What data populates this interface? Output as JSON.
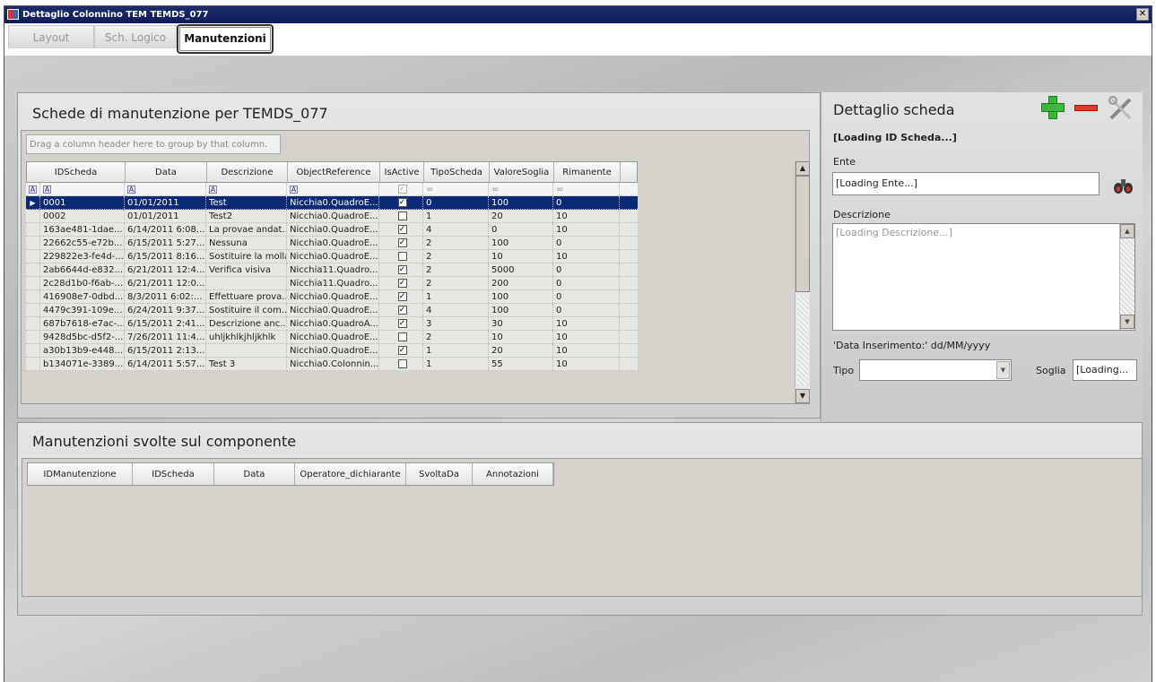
{
  "window": {
    "title": "Dettaglio Colonnino TEM TEMDS_077",
    "close_glyph": "✕"
  },
  "tabs": [
    {
      "label": "Layout"
    },
    {
      "label": "Sch. Logico"
    },
    {
      "label": "Manutenzioni"
    }
  ],
  "schede": {
    "title": "Schede di manutenzione per TEMDS_077",
    "group_hint": "Drag a column header here to group by that column.",
    "columns": [
      "IDScheda",
      "Data",
      "Descrizione",
      "ObjectReference",
      "IsActive",
      "TipoScheda",
      "ValoreSoglia",
      "Rimanente"
    ],
    "filter_glyphs": {
      "text": "A",
      "eq": "="
    },
    "rows": [
      [
        "0001",
        "01/01/2011",
        "Test",
        "Nicchia0.QuadroE...",
        "true",
        "0",
        "100",
        "0"
      ],
      [
        "0002",
        "01/01/2011",
        "Test2",
        "Nicchia0.QuadroE...",
        "false",
        "1",
        "20",
        "10"
      ],
      [
        "163ae481-1dae...",
        "6/14/2011 6:08...",
        "La provae andat...",
        "Nicchia0.QuadroE...",
        "true",
        "4",
        "0",
        "10"
      ],
      [
        "22662c55-e72b...",
        "6/15/2011 5:27...",
        "Nessuna",
        "Nicchia0.QuadroE...",
        "true",
        "2",
        "100",
        "0"
      ],
      [
        "229822e3-fe4d-...",
        "6/15/2011 8:16...",
        "Sostituire la molla",
        "Nicchia0.QuadroE...",
        "false",
        "2",
        "10",
        "10"
      ],
      [
        "2ab6644d-e832...",
        "6/21/2011 12:4...",
        "Verifica visiva",
        "Nicchia11.Quadro...",
        "true",
        "2",
        "5000",
        "0"
      ],
      [
        "2c28d1b0-f6ab-...",
        "6/21/2011 12:0...",
        "",
        "Nicchia11.Quadro...",
        "true",
        "2",
        "200",
        "0"
      ],
      [
        "416908e7-0dbd...",
        "8/3/2011 6:02:...",
        "Effettuare prova...",
        "Nicchia0.QuadroE...",
        "true",
        "1",
        "100",
        "0"
      ],
      [
        "4479c391-109e...",
        "6/24/2011 9:37...",
        "Sostituire il com...",
        "Nicchia0.QuadroE...",
        "true",
        "4",
        "100",
        "0"
      ],
      [
        "687b7618-e7ac-...",
        "6/15/2011 2:41...",
        "Descrizione anc...",
        "Nicchia0.QuadroA...",
        "true",
        "3",
        "30",
        "10"
      ],
      [
        "9428d5bc-d5f2-...",
        "7/26/2011 11:4...",
        "uhljkhlkjhljkhlk",
        "Nicchia0.QuadroE...",
        "false",
        "2",
        "10",
        "10"
      ],
      [
        "a30b13b9-e448...",
        "6/15/2011 2:13...",
        "",
        "Nicchia0.QuadroE...",
        "true",
        "1",
        "20",
        "10"
      ],
      [
        "b134071e-3389...",
        "6/14/2011 5:57...",
        "Test 3",
        "Nicchia0.Colonnin...",
        "false",
        "1",
        "55",
        "10"
      ]
    ]
  },
  "detail": {
    "title": "Dettaglio scheda",
    "id_label": "[Loading ID Scheda...]",
    "ente_label": "Ente",
    "ente_value": "[Loading Ente...]",
    "descrizione_label": "Descrizione",
    "descrizione_value": "[Loading Descrizione...]",
    "data_inserimento": "'Data Inserimento:' dd/MM/yyyy",
    "tipo_label": "Tipo",
    "tipo_value": "",
    "soglia_label": "Soglia",
    "soglia_value": "[Loading..."
  },
  "manutenzioni": {
    "title": "Manutenzioni svolte sul componente",
    "columns": [
      "IDManutenzione",
      "IDScheda",
      "Data",
      "Operatore_dichiarante",
      "SvoltaDa",
      "Annotazioni"
    ]
  },
  "colors": {
    "titlebar": "#0e1d57",
    "selected_row": "#0b2a76",
    "add_icon": "#3cb93c",
    "remove_icon": "#e23a2a"
  },
  "icons": [
    "window-icon",
    "close-icon",
    "add-icon",
    "remove-icon",
    "tools-icon",
    "binoculars-icon",
    "dropdown-arrow-icon",
    "row-indicator-icon"
  ]
}
